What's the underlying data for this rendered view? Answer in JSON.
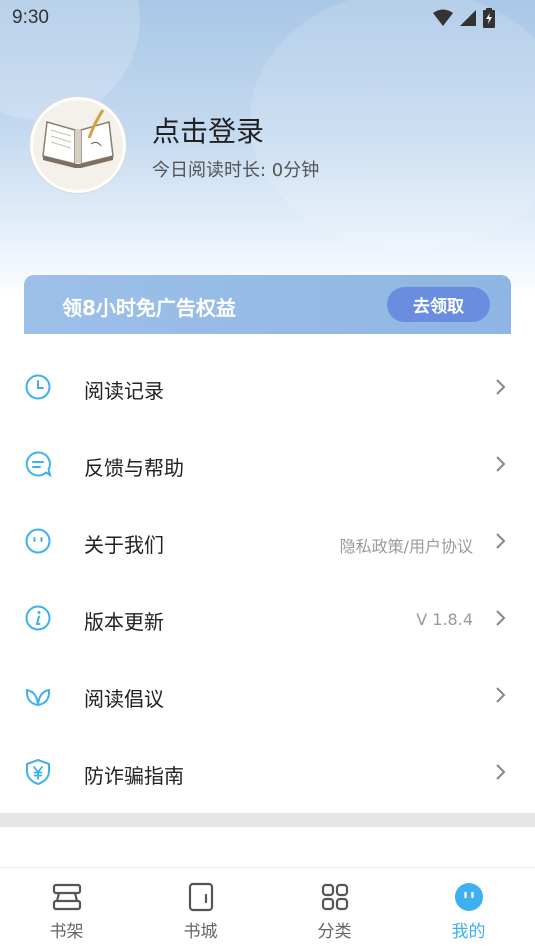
{
  "status_bar": {
    "time": "9:30"
  },
  "profile": {
    "login_label": "点击登录",
    "read_time": "今日阅读时长: 0分钟"
  },
  "promo": {
    "text": "领8小时免广告权益",
    "button_label": "去领取",
    "button_color": "#6a8de0"
  },
  "menu": {
    "items": [
      {
        "icon": "clock-icon",
        "label": "阅读记录",
        "extra": ""
      },
      {
        "icon": "chat-bubble-icon",
        "label": "反馈与帮助",
        "extra": ""
      },
      {
        "icon": "smiley-face-icon",
        "label": "关于我们",
        "extra": "隐私政策/用户协议"
      },
      {
        "icon": "info-icon",
        "label": "版本更新",
        "extra": "V 1.8.4"
      },
      {
        "icon": "leaf-icon",
        "label": "阅读倡议",
        "extra": ""
      },
      {
        "icon": "shield-yuan-icon",
        "label": "防诈骗指南",
        "extra": ""
      }
    ],
    "icon_color": "#3fb0ee"
  },
  "tabbar": {
    "tabs": [
      {
        "icon": "bookshelf-icon",
        "label": "书架",
        "active": false
      },
      {
        "icon": "book-store-icon",
        "label": "书城",
        "active": false
      },
      {
        "icon": "grid-categories-icon",
        "label": "分类",
        "active": false
      },
      {
        "icon": "profile-face-icon",
        "label": "我的",
        "active": true
      }
    ],
    "active_color": "#3fb0ee"
  }
}
